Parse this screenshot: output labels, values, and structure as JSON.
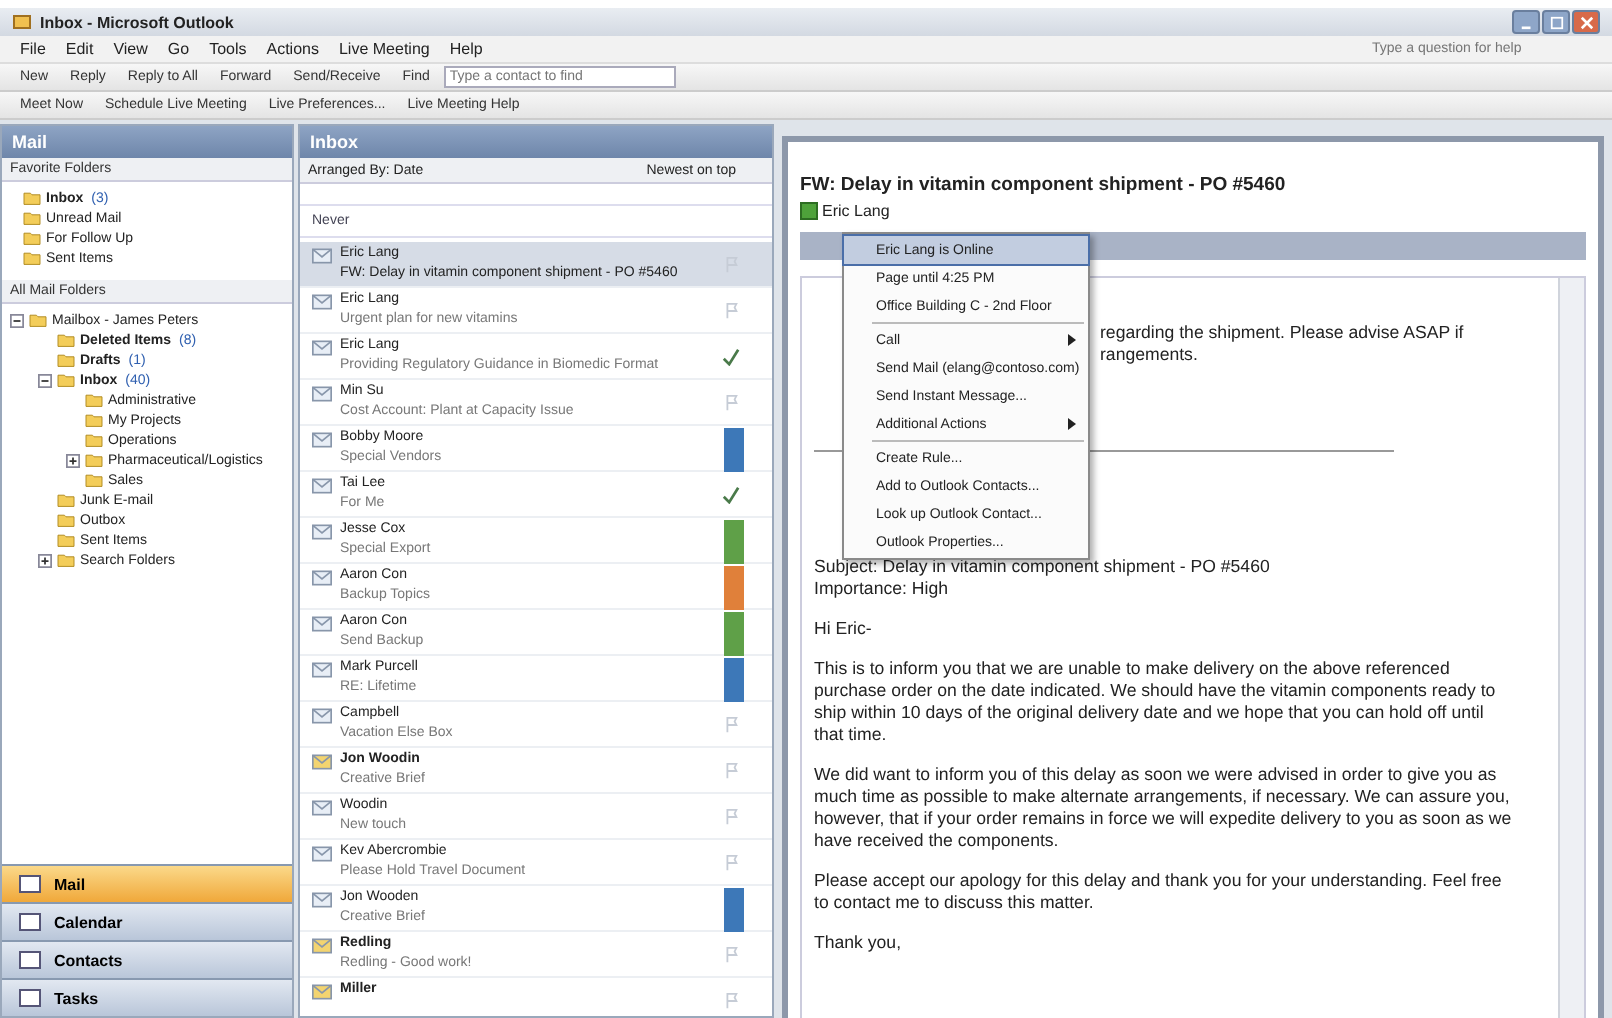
{
  "window": {
    "title": "Inbox - Microsoft Outlook"
  },
  "menu_bar": [
    "File",
    "Edit",
    "View",
    "Go",
    "Tools",
    "Actions",
    "Live Meeting",
    "Help"
  ],
  "help_search": {
    "placeholder": "Type a question for help"
  },
  "toolbar": [
    "New",
    "Reply",
    "Reply to All",
    "Forward",
    "Send/Receive",
    "Find"
  ],
  "contact_search": {
    "placeholder": "Type a contact to find"
  },
  "toolbar_2": [
    "Meet Now",
    "Schedule Live Meeting",
    "Live Preferences...",
    "Live Meeting Help"
  ],
  "navigation": {
    "title": "Mail",
    "favorites_title": "Favorite Folders",
    "favorites": [
      {
        "label": "Inbox",
        "count": "(3)",
        "unread": true
      },
      {
        "label": "Unread Mail",
        "unread": false
      },
      {
        "label": "For Follow Up",
        "unread": false
      },
      {
        "label": "Sent Items",
        "unread": false
      }
    ],
    "all_title": "All Mail Folders",
    "tree": [
      {
        "label": "Mailbox - James Peters",
        "unread": false,
        "expanded": true,
        "children": [
          {
            "label": "Deleted Items",
            "count": "(8)",
            "unread": true
          },
          {
            "label": "Drafts",
            "count": "(1)",
            "unread": true
          },
          {
            "label": "Inbox",
            "count": "(40)",
            "unread": true,
            "expanded": true,
            "children": [
              {
                "label": "Administrative",
                "unread": false
              },
              {
                "label": "My Projects",
                "unread": false
              },
              {
                "label": "Operations",
                "unread": false
              },
              {
                "label": "Pharmaceutical/Logistics",
                "unread": false,
                "expanded": false
              },
              {
                "label": "Sales",
                "unread": false
              }
            ]
          },
          {
            "label": "Junk E-mail",
            "unread": false
          },
          {
            "label": "Outbox",
            "unread": false
          },
          {
            "label": "Sent Items",
            "unread": false
          },
          {
            "label": "Search Folders",
            "unread": false,
            "expanded": false
          }
        ]
      }
    ],
    "buttons": [
      {
        "label": "Mail",
        "selected": true
      },
      {
        "label": "Calendar",
        "selected": false
      },
      {
        "label": "Contacts",
        "selected": false
      },
      {
        "label": "Tasks",
        "selected": false
      }
    ]
  },
  "message_list": {
    "title": "Inbox",
    "arranged_by": "Arranged By: Date",
    "sort": "Newest on top",
    "group": "Never",
    "messages": [
      {
        "sender": "Eric Lang",
        "subject": "FW: Delay in vitamin component shipment - PO #5460",
        "selected": true,
        "unread": false,
        "kind": "empty"
      },
      {
        "sender": "Eric Lang",
        "subject": "Urgent plan for new vitamins",
        "selected": false,
        "unread": false,
        "kind": "empty"
      },
      {
        "sender": "Eric Lang",
        "subject": "Providing Regulatory Guidance in Biomedic Format",
        "selected": false,
        "unread": false,
        "kind": "check"
      },
      {
        "sender": "Min Su",
        "subject": "Cost Account: Plant at Capacity Issue",
        "selected": false,
        "unread": false,
        "kind": "empty"
      },
      {
        "sender": "Bobby Moore",
        "subject": "Special Vendors",
        "selected": false,
        "unread": false,
        "kind": "flag",
        "color": "#3d78b8"
      },
      {
        "sender": "Tai Lee",
        "subject": "For Me",
        "selected": false,
        "unread": false,
        "kind": "check"
      },
      {
        "sender": "Jesse Cox",
        "subject": "Special Export",
        "selected": false,
        "unread": false,
        "kind": "flag",
        "color": "#5fa048"
      },
      {
        "sender": "Aaron Con",
        "subject": "Backup Topics",
        "selected": false,
        "unread": false,
        "kind": "flag",
        "color": "#e0803a"
      },
      {
        "sender": "Aaron Con",
        "subject": "Send Backup",
        "selected": false,
        "unread": false,
        "kind": "flag",
        "color": "#5fa048"
      },
      {
        "sender": "Mark Purcell",
        "subject": "RE: Lifetime",
        "selected": false,
        "unread": false,
        "kind": "flag",
        "color": "#3d78b8"
      },
      {
        "sender": "Campbell",
        "subject": "Vacation Else Box",
        "selected": false,
        "unread": false,
        "kind": "empty"
      },
      {
        "sender": "Jon Woodin",
        "subject": "Creative Brief",
        "selected": false,
        "unread": true,
        "kind": "empty"
      },
      {
        "sender": "Woodin",
        "subject": "New touch",
        "selected": false,
        "unread": false,
        "kind": "empty"
      },
      {
        "sender": "Kev Abercrombie",
        "subject": "Please Hold Travel Document",
        "selected": false,
        "unread": false,
        "kind": "empty"
      },
      {
        "sender": "Jon Wooden",
        "subject": "Creative Brief",
        "selected": false,
        "unread": false,
        "kind": "flag",
        "color": "#3d78b8"
      },
      {
        "sender": "Redling",
        "subject": "Redling - Good work!",
        "selected": false,
        "unread": true,
        "kind": "empty"
      },
      {
        "sender": "Miller",
        "selected": false,
        "unread": true,
        "kind": "empty"
      }
    ]
  },
  "reading_pane": {
    "subject": "FW: Delay in vitamin component shipment - PO #5460",
    "sender": "Eric Lang",
    "partial_lines": [
      "regarding the shipment.  Please advise ASAP if",
      "rangements."
    ],
    "header_lines": [
      "Subject: Delay in vitamin component shipment - PO #5460",
      "Importance: High"
    ],
    "paragraphs": [
      "Hi Eric-",
      "This is to inform you that we are unable to make delivery on the above referenced purchase order on the date indicated.  We should have the vitamin components ready to ship within 10 days of the original delivery date and we hope that you can hold off until that time.",
      "We did want to inform you of this delay as soon we were advised in order to give you as much time as possible to make alternate arrangements, if necessary.  We can assure you, however, that if your order remains in force we will expedite delivery to you as soon as we have received the components.",
      "Please accept our apology for this delay and thank you for your understanding.  Feel free to contact me to discuss this matter.",
      "Thank you,"
    ]
  },
  "context_menu": [
    {
      "label": "Eric Lang is Online",
      "kind": "item",
      "selected": true
    },
    {
      "label": "Page until 4:25 PM",
      "kind": "item",
      "selected": false
    },
    {
      "label": "Office Building C - 2nd Floor",
      "kind": "item",
      "selected": false
    },
    {
      "label": "Call",
      "kind": "submenu",
      "selected": false
    },
    {
      "label": "Send Mail (elang@contoso.com)",
      "kind": "item",
      "selected": false
    },
    {
      "label": "Send Instant Message...",
      "kind": "item",
      "selected": false
    },
    {
      "label": "Additional Actions",
      "kind": "submenu",
      "selected": false
    },
    {
      "label": "Create Rule...",
      "kind": "item",
      "selected": false
    },
    {
      "label": "Add to Outlook Contacts...",
      "kind": "item",
      "selected": false
    },
    {
      "label": "Look up Outlook Contact...",
      "kind": "item",
      "selected": false
    },
    {
      "label": "Outlook Properties...",
      "kind": "item",
      "selected": false
    }
  ]
}
